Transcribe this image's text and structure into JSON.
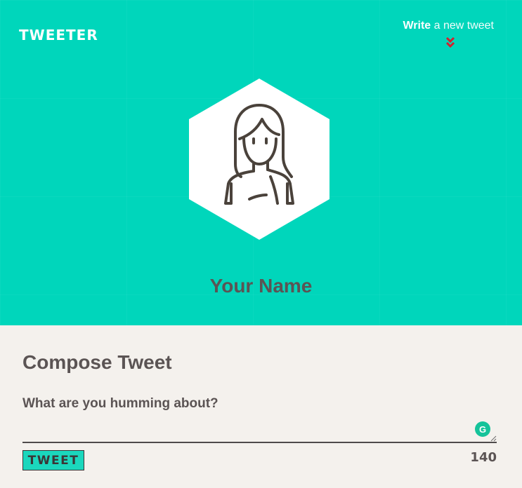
{
  "header": {
    "brand": "TWEETER",
    "write_strong": "Write",
    "write_light": " a new tweet",
    "chevron_icon": "double-chevron-down-icon",
    "accent_color": "#00d6bb",
    "chevron_color": "#d5202d"
  },
  "profile": {
    "avatar_icon": "user-avatar-icon",
    "name": "Your Name"
  },
  "compose": {
    "title": "Compose Tweet",
    "label": "What are you humming about?",
    "input_value": "",
    "grammarly_icon": "grammarly-icon",
    "grammarly_glyph": "G",
    "tweet_button": "TWEET",
    "char_count": "140"
  }
}
